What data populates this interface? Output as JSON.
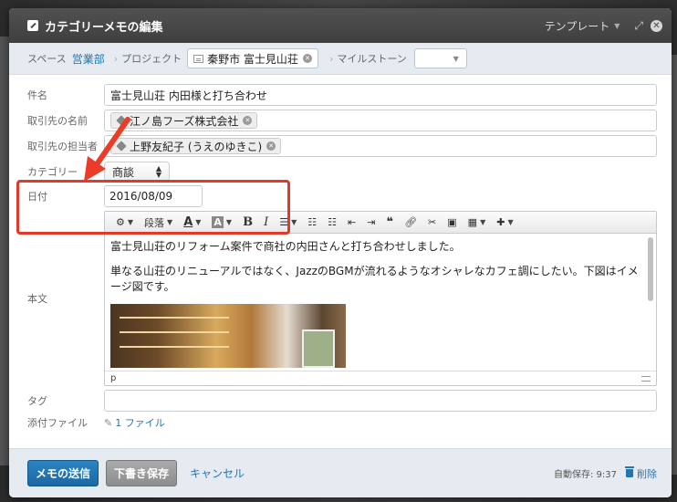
{
  "dialog": {
    "title": "カテゴリーメモの編集",
    "template_label": "テンプレート"
  },
  "crumbs": {
    "space_label": "スペース",
    "space_value": "営業部",
    "project_label": "プロジェクト",
    "project_value": "秦野市 富士見山荘",
    "milestone_label": "マイルストーン"
  },
  "form": {
    "subject_label": "件名",
    "subject_value": "富士見山荘 内田様と打ち合わせ",
    "client_name_label": "取引先の名前",
    "client_name_value": "江ノ島フーズ株式会社",
    "client_contact_label": "取引先の担当者",
    "client_contact_value": "上野友紀子 (うえのゆきこ)",
    "category_label": "カテゴリー",
    "category_value": "商談",
    "date_label": "日付",
    "date_value": "2016/08/09",
    "body_label": "本文",
    "tag_label": "タグ",
    "attachment_label": "添付ファイル",
    "attachment_value": "1 ファイル"
  },
  "editor": {
    "paragraph_menu": "段落",
    "paragraph_1": "富士見山荘のリフォーム案件で商社の内田さんと打ち合わせしました。",
    "paragraph_2": "単なる山荘のリニューアルではなく、JazzのBGMが流れるようなオシャレなカフェ調にしたい。下図はイメージ図です。",
    "status_path": "p"
  },
  "footer": {
    "send_button": "メモの送信",
    "draft_button": "下書き保存",
    "cancel_link": "キャンセル",
    "autosave_text": "自動保存: 9:37",
    "delete_link": "削除"
  },
  "colors": {
    "accent": "#2476b0",
    "highlight_box": "#e23a2a",
    "titlebar": "#474747"
  }
}
